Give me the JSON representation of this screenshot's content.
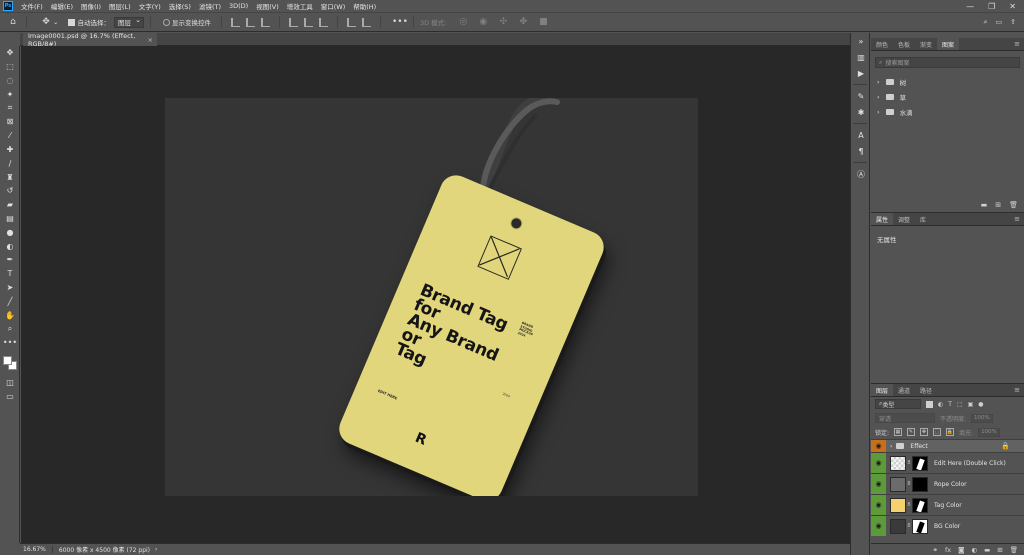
{
  "menubar": {
    "logo": "Ps",
    "items": [
      "文件(F)",
      "编辑(E)",
      "图像(I)",
      "图层(L)",
      "文字(Y)",
      "选择(S)",
      "滤镜(T)",
      "3D(D)",
      "视图(V)",
      "增效工具",
      "窗口(W)",
      "帮助(H)"
    ],
    "window_controls": [
      "—",
      "❐",
      "✕"
    ]
  },
  "options": {
    "auto_select_label": "自动选择：",
    "auto_select_value": "图层",
    "show_transform_label": "显示变换控件",
    "mode_3d_label": "3D 模式:"
  },
  "document": {
    "tab_title": "Image0001.psd @ 16.7% (Effect, RGB/8#)",
    "close": "×"
  },
  "tag": {
    "headline": "Brand Tag\nfor\nAny Brand\nor\nTag",
    "tiny_a": "BRAND STUDIO\nMOCKUP\n2024",
    "tiny_b": "2024",
    "edit_label": "EDIT HERE",
    "logo_letter": "R"
  },
  "status": {
    "zoom": "16.67%",
    "doc_info": "6000 像素 x 4500 像素 (72 ppi)",
    "arrow": "›"
  },
  "libraries_panel": {
    "tabs": [
      "颜色",
      "色板",
      "渐变",
      "图案"
    ],
    "active_tab": 3,
    "search_placeholder": "搜索图案",
    "items": [
      {
        "name": "树"
      },
      {
        "name": "草"
      },
      {
        "name": "水滴"
      }
    ]
  },
  "properties_panel": {
    "tabs": [
      "属性",
      "调整",
      "库"
    ],
    "active_tab": 0,
    "empty_text": "无属性"
  },
  "layers_panel": {
    "tabs": [
      "图层",
      "通道",
      "路径"
    ],
    "active_tab": 0,
    "filter_label": "类型",
    "blend_mode": "穿透",
    "opacity_label": "不透明度:",
    "opacity_value": "100%",
    "lock_label": "锁定:",
    "fill_label": "填充:",
    "fill_value": "100%",
    "layers": [
      {
        "name": "Effect",
        "kind": "group",
        "eye": "orange",
        "thumb": "",
        "locked": true
      },
      {
        "name": "Edit Here (Double Click)",
        "kind": "smart",
        "eye": "green",
        "thumb": "#9a9a9a",
        "locked": false
      },
      {
        "name": "Rope Color",
        "kind": "fill",
        "eye": "green",
        "thumb": "#6b6b6b",
        "locked": false
      },
      {
        "name": "Tag Color",
        "kind": "fill",
        "eye": "green",
        "thumb": "#f4d06f",
        "locked": false
      },
      {
        "name": "BG Color",
        "kind": "fill",
        "eye": "green",
        "thumb": "#3a3a3a",
        "locked": false
      }
    ]
  },
  "colors": {
    "tag": "#e1d67c",
    "artboard": "#353535",
    "workspace": "#282828",
    "eye_active": "#5c9a3a",
    "eye_group": "#c96f1c"
  }
}
